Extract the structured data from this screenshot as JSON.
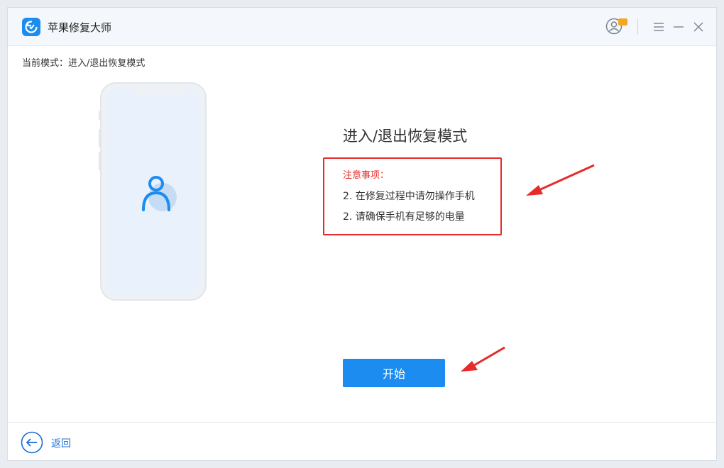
{
  "app": {
    "title": "苹果修复大师",
    "accent_color": "#1c8cf0",
    "logo_icon": "app-logo-icon"
  },
  "titlebar": {
    "user_icon": "user-account-icon",
    "menu_icon": "menu-icon",
    "minimize_icon": "minimize-icon",
    "close_icon": "close-icon"
  },
  "mode": {
    "current": "当前模式：进入/退出恢复模式"
  },
  "content": {
    "heading": "进入/退出恢复模式",
    "notice": {
      "title": "注意事项：",
      "items": [
        "2. 在修复过程中请勿操作手机",
        "2. 请确保手机有足够的电量"
      ],
      "border_color": "#e52b2b"
    },
    "start_label": "开始"
  },
  "footer": {
    "back_label": "返回"
  }
}
